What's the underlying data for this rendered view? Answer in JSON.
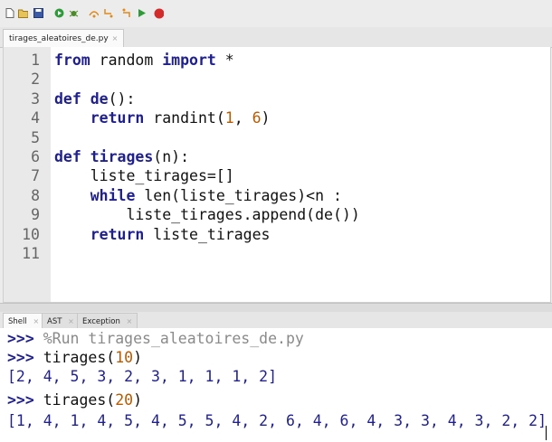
{
  "toolbar": {
    "icons": [
      "new-file-icon",
      "open-file-icon",
      "save-icon",
      "run-icon",
      "debug-icon",
      "step-over-icon",
      "step-into-icon",
      "step-out-icon",
      "resume-icon",
      "stop-icon"
    ],
    "stop_label": "STOP"
  },
  "editor": {
    "tab_label": "tirages_aleatoires_de.py",
    "tab_close": "×",
    "lines": [
      {
        "n": "1",
        "t": [
          {
            "k": "kw",
            "v": "from"
          },
          {
            "k": "tx",
            "v": " random "
          },
          {
            "k": "kw",
            "v": "import"
          },
          {
            "k": "tx",
            "v": " *"
          }
        ]
      },
      {
        "n": "2",
        "t": []
      },
      {
        "n": "3",
        "t": [
          {
            "k": "kw",
            "v": "def"
          },
          {
            "k": "tx",
            "v": " "
          },
          {
            "k": "kw",
            "v": "de"
          },
          {
            "k": "tx",
            "v": "():"
          }
        ]
      },
      {
        "n": "4",
        "t": [
          {
            "k": "tx",
            "v": "    "
          },
          {
            "k": "kw",
            "v": "return"
          },
          {
            "k": "tx",
            "v": " randint("
          },
          {
            "k": "nm",
            "v": "1"
          },
          {
            "k": "tx",
            "v": ", "
          },
          {
            "k": "nm",
            "v": "6"
          },
          {
            "k": "tx",
            "v": ")"
          }
        ]
      },
      {
        "n": "5",
        "t": []
      },
      {
        "n": "6",
        "t": [
          {
            "k": "kw",
            "v": "def"
          },
          {
            "k": "tx",
            "v": " "
          },
          {
            "k": "kw",
            "v": "tirages"
          },
          {
            "k": "tx",
            "v": "(n):"
          }
        ]
      },
      {
        "n": "7",
        "t": [
          {
            "k": "tx",
            "v": "    liste_tirages=[]"
          }
        ]
      },
      {
        "n": "8",
        "t": [
          {
            "k": "tx",
            "v": "    "
          },
          {
            "k": "kw",
            "v": "while"
          },
          {
            "k": "tx",
            "v": " len(liste_tirages)<n :"
          }
        ]
      },
      {
        "n": "9",
        "t": [
          {
            "k": "tx",
            "v": "        liste_tirages.append(de())"
          }
        ]
      },
      {
        "n": "10",
        "t": [
          {
            "k": "tx",
            "v": "    "
          },
          {
            "k": "kw",
            "v": "return"
          },
          {
            "k": "tx",
            "v": " liste_tirages"
          }
        ]
      },
      {
        "n": "11",
        "t": []
      }
    ]
  },
  "shell_tabs": [
    {
      "label": "Shell",
      "close": "×"
    },
    {
      "label": "AST",
      "close": "×"
    },
    {
      "label": "Exception",
      "close": "×"
    }
  ],
  "shell": {
    "prompt": ">>>",
    "run_cmd": "%Run tirages_aleatoires_de.py",
    "cmd1_pre": "tirages(",
    "cmd1_arg": "10",
    "cmd1_post": ")",
    "out1": "[2, 4, 5, 3, 2, 3, 1, 1, 1, 2]",
    "cmd2_pre": "tirages(",
    "cmd2_arg": "20",
    "cmd2_post": ")",
    "out2": "[1, 4, 1, 4, 5, 4, 5, 5, 4, 2, 6, 4, 6, 4, 3, 3, 4, 3, 2, 2]"
  },
  "colors": {
    "keyword": "#1f1f8f",
    "number": "#b85a00",
    "magic": "#8a8a8a",
    "gutter": "#e9e9e9"
  }
}
